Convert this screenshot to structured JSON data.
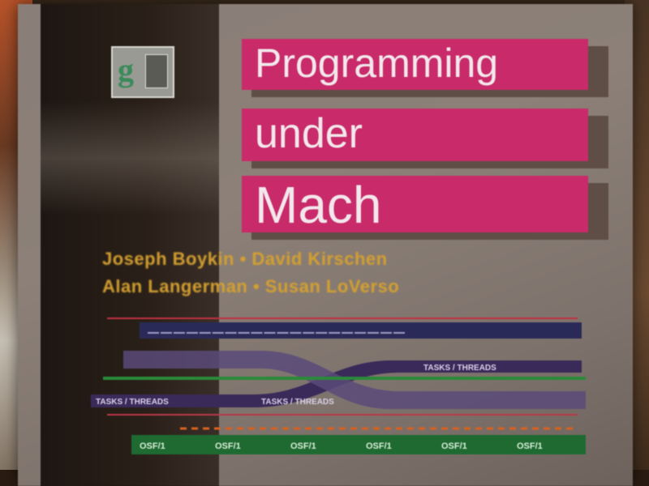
{
  "cover": {
    "title_line1": "Programming",
    "title_line2": "under",
    "title_line3": "Mach",
    "authors_line1": "Joseph Boykin • David Kirschen",
    "authors_line2": "Alan Langerman • Susan LoVerso",
    "tasks_label": "TASKS / THREADS",
    "os_label": "OSF/1"
  },
  "colors": {
    "title_bar": "#c82a6a",
    "authors": "#d4a030",
    "cover": "#8a7f78"
  }
}
